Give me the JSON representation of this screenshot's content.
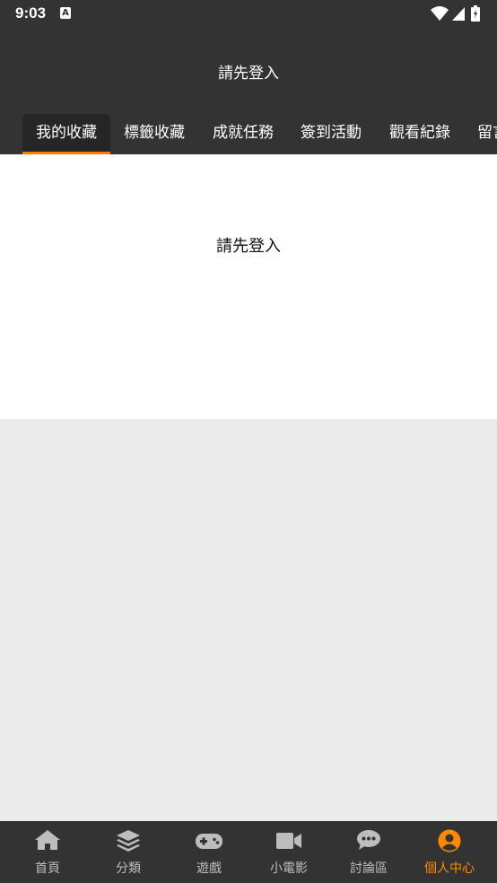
{
  "status_bar": {
    "time": "9:03",
    "notification_icon": "A"
  },
  "header": {
    "title": "請先登入"
  },
  "tabs": [
    {
      "label": "我的收藏",
      "active": true
    },
    {
      "label": "標籤收藏",
      "active": false
    },
    {
      "label": "成就任務",
      "active": false
    },
    {
      "label": "簽到活動",
      "active": false
    },
    {
      "label": "觀看紀錄",
      "active": false
    },
    {
      "label": "留言",
      "active": false
    }
  ],
  "content": {
    "message": "請先登入"
  },
  "bottom_nav": [
    {
      "label": "首頁",
      "icon": "home-icon",
      "active": false
    },
    {
      "label": "分類",
      "icon": "layers-icon",
      "active": false
    },
    {
      "label": "遊戲",
      "icon": "gamepad-icon",
      "active": false
    },
    {
      "label": "小電影",
      "icon": "video-icon",
      "active": false
    },
    {
      "label": "討論區",
      "icon": "chat-icon",
      "active": false
    },
    {
      "label": "個人中心",
      "icon": "user-circle-icon",
      "active": true
    }
  ],
  "colors": {
    "header_bg": "#333333",
    "accent": "#ff7a00",
    "active_nav": "#ff8a00",
    "inactive_nav": "#bdbdbd",
    "page_bg": "#ebebeb"
  }
}
